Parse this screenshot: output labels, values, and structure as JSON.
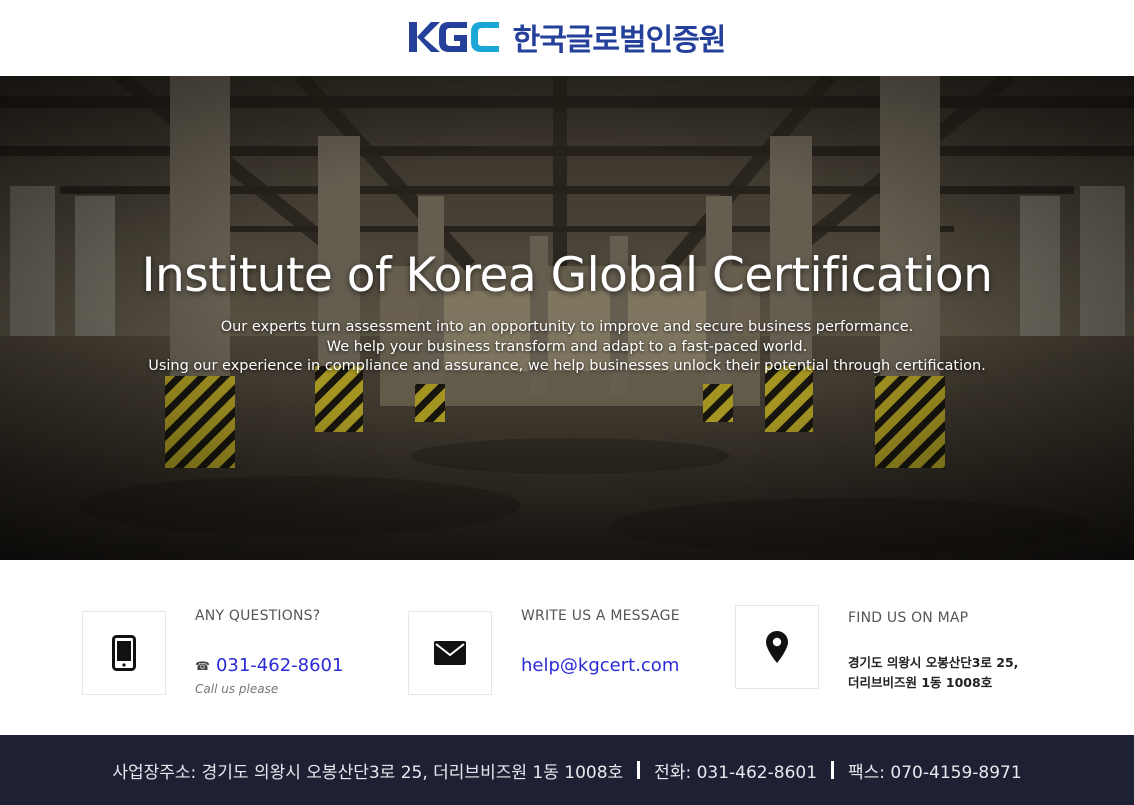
{
  "header": {
    "logo_mark": "KGC",
    "logo_text": "한국글로벌인증원"
  },
  "hero": {
    "title": "Institute of Korea Global Certification",
    "lines": [
      "Our experts turn assessment into an opportunity to improve and secure business performance.",
      "We help your business transform and adapt to a fast-paced world.",
      "Using our experience in compliance and assurance, we help businesses unlock their potential through certification."
    ]
  },
  "contact": {
    "phone": {
      "heading": "ANY QUESTIONS?",
      "value": "031-462-8601",
      "sub": "Call us please",
      "icon": "mobile-phone-icon"
    },
    "email": {
      "heading": "WRITE US A MESSAGE",
      "value": "help@kgcert.com",
      "icon": "envelope-icon"
    },
    "map": {
      "heading": "FIND US ON MAP",
      "address_line1": "경기도 의왕시 오봉산단3로 25,",
      "address_line2": "더리브비즈원 1동 1008호",
      "icon": "map-pin-icon"
    }
  },
  "footer": {
    "address": "사업장주소: 경기도 의왕시 오봉산단3로 25, 더리브비즈원 1동 1008호",
    "phone": "전화: 031-462-8601",
    "fax": "팩스: 070-4159-8971"
  },
  "colors": {
    "brand_blue": "#25409a",
    "link_blue": "#2a2ad6",
    "footer_bg": "#1e2133"
  }
}
